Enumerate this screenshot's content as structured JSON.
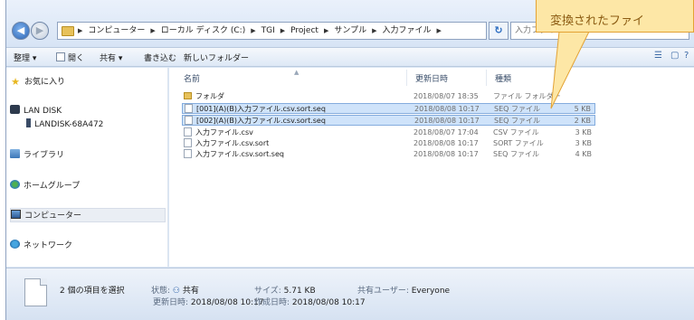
{
  "addressbar": {
    "crumbs": [
      "コンピューター",
      "ローカル ディスク (C:)",
      "TGI",
      "Project",
      "サンプル",
      "入力ファイル"
    ],
    "search_placeholder": "入力ファイルの検索"
  },
  "toolbar": {
    "organize": "整理 ▾",
    "open": "開く",
    "share": "共有 ▾",
    "burn": "書き込む",
    "new_folder": "新しいフォルダー"
  },
  "sidebar": {
    "items": [
      {
        "label": "お気に入り",
        "icon": "star-icon"
      },
      {
        "label": "LAN DISK",
        "icon": "lan-disk-icon"
      },
      {
        "label": "LANDISK-68A472",
        "icon": "network-drive-icon"
      },
      {
        "label": "ライブラリ",
        "icon": "library-icon"
      },
      {
        "label": "ホームグループ",
        "icon": "homegroup-icon"
      },
      {
        "label": "コンピューター",
        "icon": "computer-icon"
      },
      {
        "label": "ネットワーク",
        "icon": "network-icon"
      }
    ]
  },
  "filelist": {
    "columns": {
      "name": "名前",
      "date": "更新日時",
      "type": "種類"
    },
    "rows": [
      {
        "name": "フォルダ",
        "date": "2018/08/07 18:35",
        "type": "ファイル フォルダー",
        "size": "",
        "selected": false,
        "icon": "folder-icon"
      },
      {
        "name": "[001](A)(B)入力ファイル.csv.sort.seq",
        "date": "2018/08/08 10:17",
        "type": "SEQ ファイル",
        "size": "5 KB",
        "selected": true,
        "icon": "file-icon"
      },
      {
        "name": "[002](A)(B)入力ファイル.csv.sort.seq",
        "date": "2018/08/08 10:17",
        "type": "SEQ ファイル",
        "size": "2 KB",
        "selected": true,
        "icon": "file-icon"
      },
      {
        "name": "入力ファイル.csv",
        "date": "2018/08/07 17:04",
        "type": "CSV ファイル",
        "size": "3 KB",
        "selected": false,
        "icon": "file-icon"
      },
      {
        "name": "入力ファイル.csv.sort",
        "date": "2018/08/08 10:17",
        "type": "SORT ファイル",
        "size": "3 KB",
        "selected": false,
        "icon": "file-icon"
      },
      {
        "name": "入力ファイル.csv.sort.seq",
        "date": "2018/08/08 10:17",
        "type": "SEQ ファイル",
        "size": "4 KB",
        "selected": false,
        "icon": "file-icon"
      }
    ]
  },
  "details": {
    "selection": "2 個の項目を選択",
    "status_label": "状態:",
    "status_value": "共有",
    "size_label": "サイズ:",
    "size_value": "5.71 KB",
    "shared_label": "共有ユーザー:",
    "shared_value": "Everyone",
    "modified_label": "更新日時:",
    "modified_value": "2018/08/08 10:17",
    "created_label": "作成日時:",
    "created_value": "2018/08/08 10:17"
  },
  "callout": {
    "text": "変換されたファイ"
  },
  "colors": {
    "selection": "#cfe3fa",
    "callout_fill": "#fde7a6",
    "callout_border": "#e3a233"
  }
}
